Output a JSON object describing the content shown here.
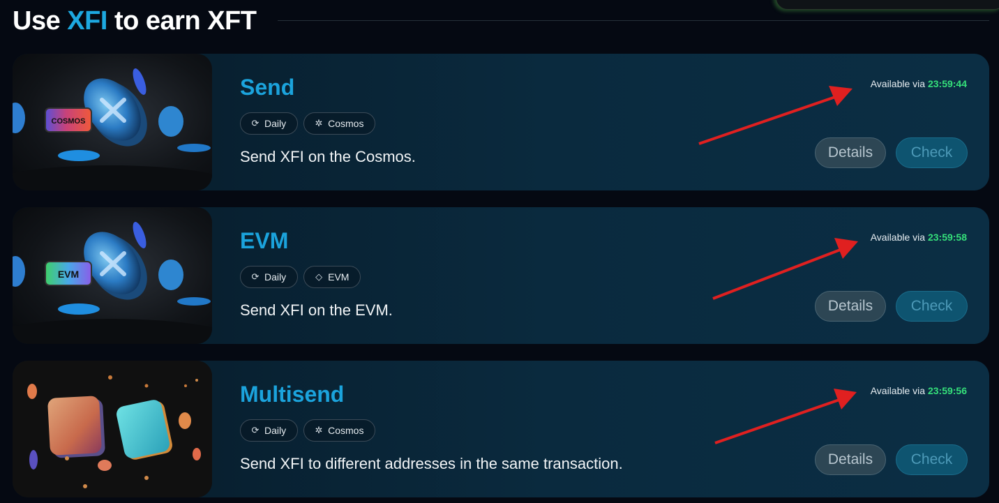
{
  "header": {
    "title_prefix": "Use ",
    "title_accent": "XFI",
    "title_suffix": " to earn XFT"
  },
  "colors": {
    "accent": "#1da8e0",
    "timer": "#35e07a",
    "arrow": "#e02020"
  },
  "tasks": [
    {
      "title": "Send",
      "image_badge": "COSMOS",
      "tags": [
        {
          "icon": "refresh-icon",
          "label": "Daily"
        },
        {
          "icon": "cosmos-icon",
          "label": "Cosmos"
        }
      ],
      "description": "Send XFI on the Cosmos.",
      "availability_label": "Available via",
      "availability_time": "23:59:44",
      "details_label": "Details",
      "check_label": "Check"
    },
    {
      "title": "EVM",
      "image_badge": "EVM",
      "tags": [
        {
          "icon": "refresh-icon",
          "label": "Daily"
        },
        {
          "icon": "ethereum-icon",
          "label": "EVM"
        }
      ],
      "description": "Send XFI on the EVM.",
      "availability_label": "Available via",
      "availability_time": "23:59:58",
      "details_label": "Details",
      "check_label": "Check"
    },
    {
      "title": "Multisend",
      "tags": [
        {
          "icon": "refresh-icon",
          "label": "Daily"
        },
        {
          "icon": "cosmos-icon",
          "label": "Cosmos"
        }
      ],
      "description": "Send XFI to different addresses in the same transaction.",
      "availability_label": "Available via",
      "availability_time": "23:59:56",
      "details_label": "Details",
      "check_label": "Check"
    }
  ]
}
